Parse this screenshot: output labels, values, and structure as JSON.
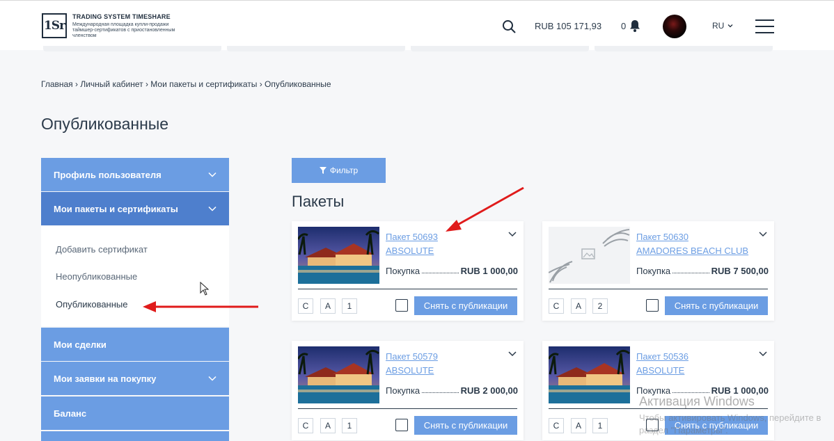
{
  "header": {
    "logo_mark": "1Sr",
    "logo_title": "TRADING SYSTEM TIMESHARE",
    "logo_subtitle": "Международная площадка купли-продажи таймшер-сертификатов с приостановленным членством",
    "balance": "RUB 105 171,93",
    "notifications_count": "0",
    "language": "RU"
  },
  "breadcrumb": "Главная › Личный кабинет › Мои пакеты и сертификаты › Опубликованные",
  "page_title": "Опубликованные",
  "sidebar": {
    "items": [
      {
        "label": "Профиль пользователя"
      },
      {
        "label": "Мои пакеты и сертификаты"
      },
      {
        "label": "Мои сделки"
      },
      {
        "label": "Мои заявки на покупку"
      },
      {
        "label": "Баланс"
      }
    ],
    "submenu": [
      {
        "label": "Добавить сертификат"
      },
      {
        "label": "Неопубликованные"
      },
      {
        "label": "Опубликованные"
      }
    ]
  },
  "filter_label": "Фильтр",
  "section_title": "Пакеты",
  "cards": [
    {
      "package": "Пакет 50693",
      "club": "ABSOLUTE",
      "price_label": "Покупка",
      "price": "RUB 1 000,00",
      "tags": [
        "C",
        "A",
        "1"
      ],
      "button": "Снять с публикации"
    },
    {
      "package": "Пакет 50630",
      "club": "AMADORES BEACH CLUB",
      "price_label": "Покупка",
      "price": "RUB 7 500,00",
      "tags": [
        "C",
        "A",
        "2"
      ],
      "button": "Снять с публикации"
    },
    {
      "package": "Пакет 50579",
      "club": "ABSOLUTE",
      "price_label": "Покупка",
      "price": "RUB 2 000,00",
      "tags": [
        "C",
        "A",
        "1"
      ],
      "button": "Снять с публикации"
    },
    {
      "package": "Пакет 50536",
      "club": "ABSOLUTE",
      "price_label": "Покупка",
      "price": "RUB 1 000,00",
      "tags": [
        "C",
        "A",
        "1"
      ],
      "button": "Снять с публикации"
    }
  ],
  "watermark": {
    "line1": "Активация Windows",
    "line2": "Чтобы активировать Windows, перейдите в раздел \"Параметры\"."
  },
  "colors": {
    "accent": "#6b9de3",
    "accent_active": "#4e7fcd",
    "text": "#2b3a4a",
    "annotation_arrow": "#e01b1b"
  },
  "icons": [
    "search-icon",
    "bell-icon",
    "chevron-down-icon",
    "menu-icon",
    "filter-icon",
    "image-placeholder-icon",
    "arrow-annotation",
    "mouse-cursor-icon"
  ]
}
